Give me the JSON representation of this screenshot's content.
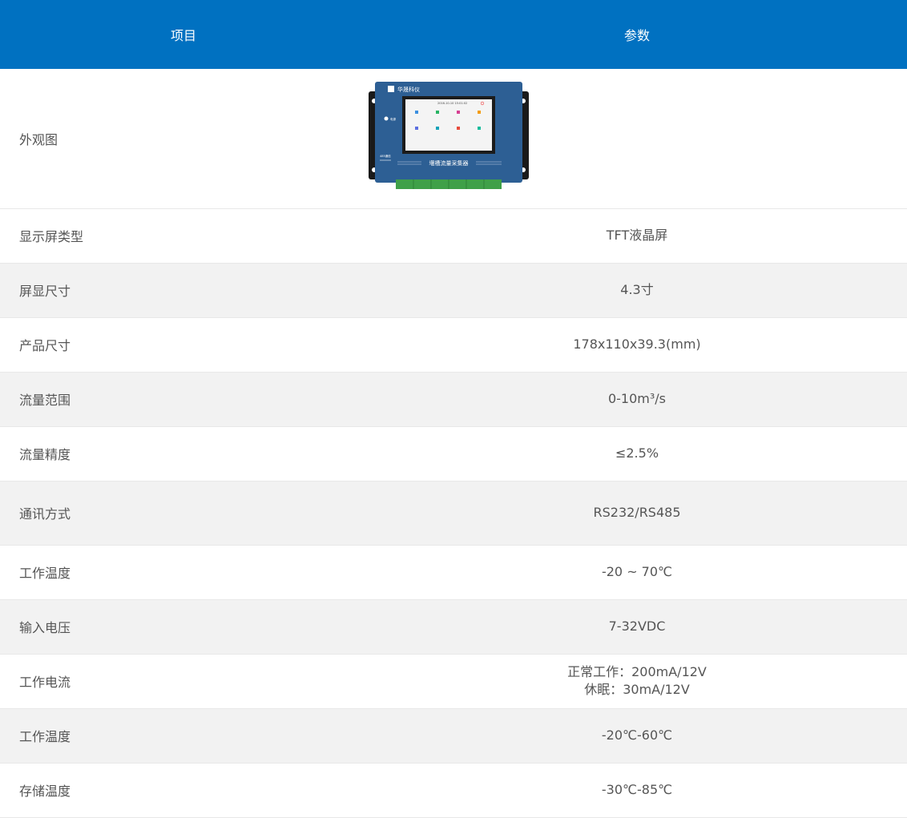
{
  "header": {
    "col_item": "项目",
    "col_param": "参数"
  },
  "appearance": {
    "label": "外观图",
    "device": {
      "brand": "华晟科仪",
      "device_name": "堰槽流量采集器",
      "screen_datetime": "2016-10-10 15:01:02",
      "power_label": "电源",
      "comm_label": "485通信",
      "screen_icons": [
        "实时数据",
        "系统设置",
        "通讯设置",
        "传感器设置",
        "历史数据",
        "Modbus测试",
        "恢复出厂",
        "关于"
      ],
      "body_color": "#2d5f94",
      "terminal_color": "#3fa048"
    }
  },
  "rows": [
    {
      "label": "显示屏类型",
      "value": [
        "TFT液晶屏"
      ]
    },
    {
      "label": "屏显尺寸",
      "value": [
        "4.3寸"
      ]
    },
    {
      "label": "产品尺寸",
      "value": [
        "178x110x39.3(mm)"
      ]
    },
    {
      "label": "流量范围",
      "value": [
        "0-10m³/s"
      ]
    },
    {
      "label": "流量精度",
      "value": [
        "≤2.5%"
      ]
    },
    {
      "label": "通讯方式",
      "value": [
        "RS232/RS485"
      ]
    },
    {
      "label": "工作温度",
      "value": [
        "-20 ~ 70℃"
      ]
    },
    {
      "label": "输入电压",
      "value": [
        "7-32VDC"
      ]
    },
    {
      "label": "工作电流",
      "value": [
        "正常工作：200mA/12V",
        "休眠：30mA/12V"
      ]
    },
    {
      "label": "工作温度",
      "value": [
        "-20℃-60℃"
      ]
    },
    {
      "label": "存储温度",
      "value": [
        "-30℃-85℃"
      ]
    }
  ],
  "colors": {
    "header_bg": "#0071c1",
    "header_text": "#ffffff",
    "row_alt_bg": "#f2f2f2",
    "text": "#555555"
  }
}
